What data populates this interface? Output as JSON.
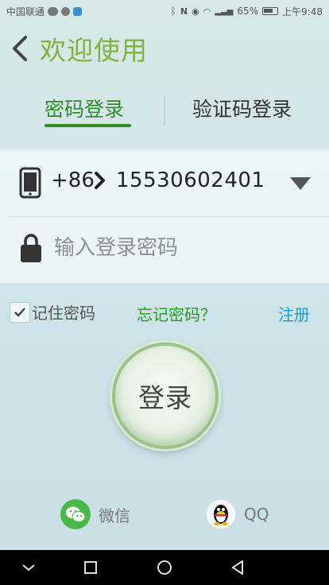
{
  "statusbar": {
    "carrier": "中国联通",
    "battery_percent": "65%",
    "time": "上午9:48",
    "icons": [
      "wechat-icon",
      "chat-icon",
      "shield-icon",
      "bluetooth-icon",
      "nfc-icon",
      "eye-icon",
      "wifi-icon",
      "signal-icon",
      "battery-icon"
    ]
  },
  "header": {
    "title": "欢迎使用",
    "back_icon": "back-arrow-icon",
    "title_color": "#7fb340"
  },
  "tabs": [
    {
      "label": "密码登录",
      "active": true
    },
    {
      "label": "验证码登录",
      "active": false
    }
  ],
  "form": {
    "country_code": "+86",
    "phone_number": "15530602401",
    "password_placeholder": "输入登录密码",
    "password_value": ""
  },
  "options": {
    "remember_label": "记住密码",
    "remember_checked": true,
    "forgot_label": "忘记密码？",
    "register_label": "注册"
  },
  "login_button": {
    "label": "登录"
  },
  "social": {
    "wechat_label": "微信",
    "qq_label": "QQ"
  },
  "colors": {
    "accent_green": "#2e8c27",
    "link_blue": "#1e9ad6",
    "title_green": "#7fb340"
  }
}
